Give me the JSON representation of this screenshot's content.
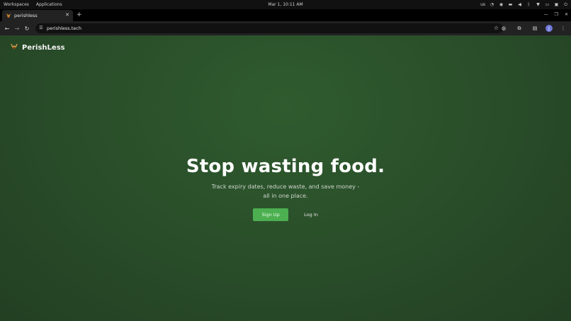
{
  "os": {
    "workspaces_label": "Workspaces",
    "applications_label": "Applications",
    "clock": "Mar 1, 10:11 AM",
    "keyboard_layout": "us",
    "tray_icons": [
      "sync-icon",
      "accessibility-icon",
      "window-icon",
      "volume-icon",
      "bluetooth-icon",
      "wifi-icon",
      "battery-icon",
      "notifications-icon",
      "power-icon"
    ]
  },
  "browser": {
    "tab_title": "perishless",
    "url": "perishless.tech",
    "profile_initial": "J"
  },
  "page": {
    "brand": "PerishLess",
    "hero_title": "Stop wasting food.",
    "hero_subtitle": "Track expiry dates, reduce waste, and save money - all in one place.",
    "signup_label": "Sign Up",
    "login_label": "Log In"
  },
  "colors": {
    "accent_green": "#4caf50",
    "page_bg": "#2a4f2a"
  }
}
